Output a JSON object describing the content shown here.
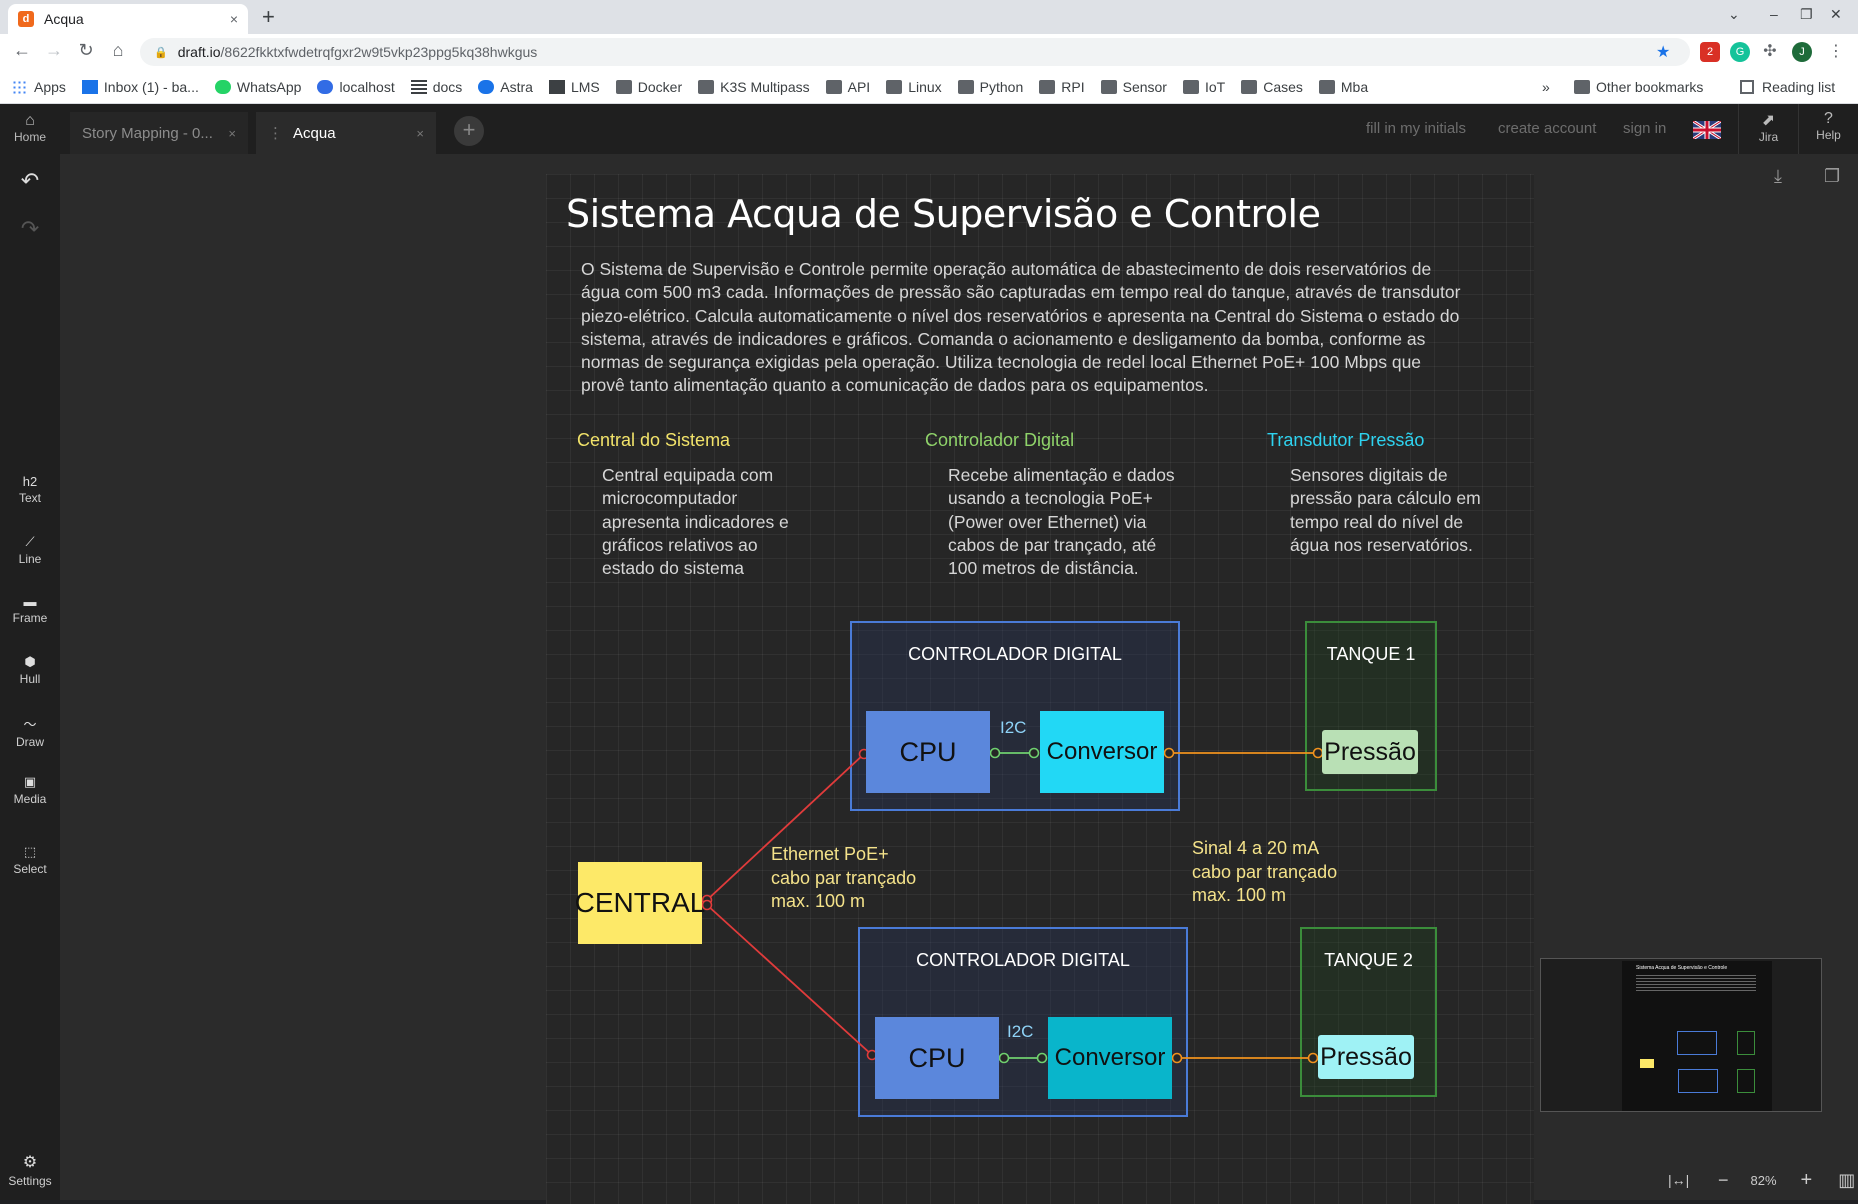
{
  "browser": {
    "tab_title": "Acqua",
    "tab_close": "×",
    "new_tab": "+",
    "url_host": "draft.io",
    "url_path": "/8622fkktxfwdetrqfgxr2w9t5vkp23ppg5kq38hwkgus",
    "extension_badge": "2",
    "profile_initial": "J",
    "bookmarks": [
      {
        "label": "Apps",
        "icon": "apps-grid-icon"
      },
      {
        "label": "Inbox (1) - ba...",
        "icon": "mail-icon"
      },
      {
        "label": "WhatsApp",
        "icon": "whatsapp-icon"
      },
      {
        "label": "localhost",
        "icon": "kubernetes-icon"
      },
      {
        "label": "docs",
        "icon": "docs-icon"
      },
      {
        "label": "Astra",
        "icon": "astra-icon"
      },
      {
        "label": "LMS",
        "icon": "lms-icon"
      },
      {
        "label": "Docker",
        "icon": "folder-icon"
      },
      {
        "label": "K3S Multipass",
        "icon": "folder-icon"
      },
      {
        "label": "API",
        "icon": "folder-icon"
      },
      {
        "label": "Linux",
        "icon": "folder-icon"
      },
      {
        "label": "Python",
        "icon": "folder-icon"
      },
      {
        "label": "RPI",
        "icon": "folder-icon"
      },
      {
        "label": "Sensor",
        "icon": "folder-icon"
      },
      {
        "label": "IoT",
        "icon": "folder-icon"
      },
      {
        "label": "Cases",
        "icon": "folder-icon"
      },
      {
        "label": "Mba",
        "icon": "folder-icon"
      }
    ],
    "bookmarks_overflow": "»",
    "other_bookmarks": "Other bookmarks",
    "reading_list": "Reading list"
  },
  "app": {
    "home_label": "Home",
    "tabs": [
      {
        "label": "Story Mapping - 0...",
        "active": false
      },
      {
        "label": "Acqua",
        "active": true
      }
    ],
    "add_tab": "+",
    "tab_close": "×",
    "top_links": {
      "initials": "fill in my initials",
      "create": "create account",
      "signin": "sign in"
    },
    "jira_label": "Jira",
    "help_label": "Help",
    "help_glyph": "?",
    "tools": [
      {
        "glyph": "h2",
        "label": "Text"
      },
      {
        "glyph": "⟋",
        "label": "Line"
      },
      {
        "glyph": "▬",
        "label": "Frame"
      },
      {
        "glyph": "⬢",
        "label": "Hull"
      },
      {
        "glyph": "～",
        "label": "Draw"
      },
      {
        "glyph": "▣",
        "label": "Media"
      },
      {
        "glyph": "⬚",
        "label": "Select"
      }
    ],
    "undo_glyph": "↶",
    "redo_glyph": "↷",
    "settings_glyph": "⚙",
    "settings_label": "Settings",
    "download_glyph": "⤓",
    "copy_glyph": "❐",
    "zoom": {
      "fit": "|↔|",
      "minus": "−",
      "value": "82%",
      "plus": "+",
      "map": "▥"
    }
  },
  "doc": {
    "title": "Sistema Acqua de Supervisão e Controle",
    "paragraph_lines": [
      "O Sistema de Supervisão e Controle permite operação automática de abastecimento de dois reservatórios de",
      "água com 500 m3 cada. Informações de pressão são capturadas em tempo real do tanque, através de transdutor",
      "piezo-elétrico. Calcula automaticamente o nível dos reservatórios e apresenta na Central do Sistema o estado do",
      "sistema, através de indicadores e gráficos. Comanda o acionamento e desligamento da bomba, conforme as",
      "normas de segurança exigidas pela operação. Utiliza tecnologia de redel local Ethernet PoE+ 100 Mbps que",
      "provê tanto alimentação quanto a comunicação de dados para os equipamentos."
    ],
    "columns": [
      {
        "heading": "Central do Sistema",
        "color": "#f2e36a",
        "lines": [
          "Central equipada com",
          "microcomputador",
          "apresenta indicadores e",
          "gráficos relativos ao",
          "estado do sistema"
        ]
      },
      {
        "heading": "Controlador Digital",
        "color": "#8fd36a",
        "lines": [
          "Recebe alimentação e dados",
          "usando a tecnologia  PoE+",
          "(Power over Ethernet) via",
          "cabos de par trançado, até",
          "100 metros de distância."
        ]
      },
      {
        "heading": "Transdutor Pressão",
        "color": "#2ed3f0",
        "lines": [
          "Sensores digitais de",
          "pressão para cálculo em",
          "tempo real do nível de",
          "água nos reservatórios."
        ]
      }
    ]
  },
  "diagram": {
    "controller_title": "CONTROLADOR DIGITAL",
    "tank1_title": "TANQUE 1",
    "tank2_title": "TANQUE 2",
    "cpu": "CPU",
    "converter": "Conversor",
    "i2c": "I2C",
    "pressure": "Pressão",
    "central": "CENTRAL",
    "ethernet_label": [
      "Ethernet PoE+",
      "cabo par trançado",
      "max. 100 m"
    ],
    "signal_label": [
      "Sinal 4 a 20 mA",
      "cabo par trançado",
      "max. 100 m"
    ],
    "colors": {
      "central": "#fde968",
      "cpu": "#5b87dc",
      "converter1": "#22d8f5",
      "converter2": "#09b5cb",
      "pressure1": "#b9e0b5",
      "pressure2": "#9ff2f5",
      "frame_blue": "#4a7bd8",
      "frame_green": "#3b8d3b",
      "ethernet_line": "#e03b3b",
      "i2c_line": "#6fd06f",
      "signal_line": "#f0921e"
    }
  },
  "minimap": {
    "title": "Sistema Acqua de Supervisão e Controle"
  }
}
